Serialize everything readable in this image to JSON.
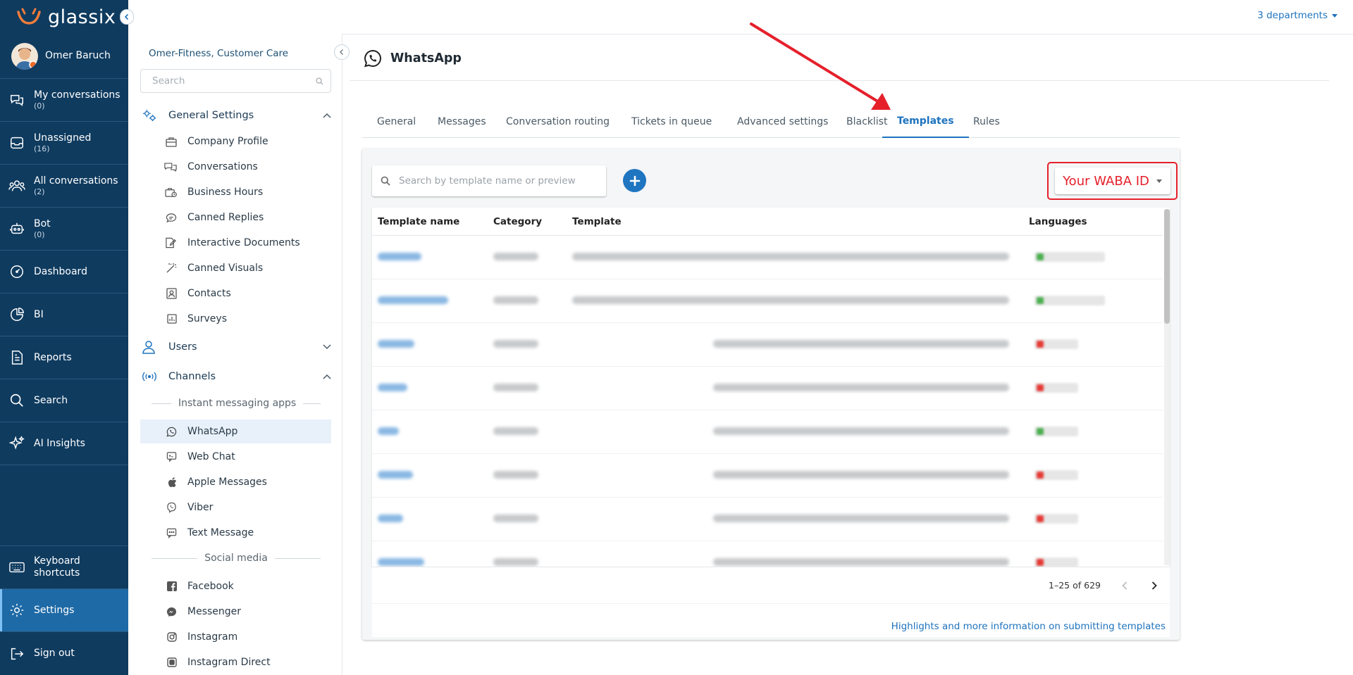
{
  "brand": {
    "name": "glassix"
  },
  "user": {
    "name": "Omer Baruch"
  },
  "nav": {
    "items": [
      {
        "label": "My conversations",
        "count": "(0)"
      },
      {
        "label": "Unassigned",
        "count": "(16)"
      },
      {
        "label": "All conversations",
        "count": "(2)"
      },
      {
        "label": "Bot",
        "count": "(0)"
      },
      {
        "label": "Dashboard"
      },
      {
        "label": "BI"
      },
      {
        "label": "Reports"
      },
      {
        "label": "Search"
      },
      {
        "label": "AI Insights"
      }
    ],
    "keyboard": "Keyboard shortcuts",
    "settings": "Settings",
    "signout": "Sign out"
  },
  "header": {
    "departments": "3 departments"
  },
  "sidebar": {
    "org": "Omer-Fitness, Customer Care",
    "search_placeholder": "Search",
    "general": {
      "label": "General Settings",
      "items": [
        "Company Profile",
        "Conversations",
        "Business Hours",
        "Canned Replies",
        "Interactive Documents",
        "Canned Visuals",
        "Contacts",
        "Surveys"
      ]
    },
    "users": "Users",
    "channels": {
      "label": "Channels",
      "group_im": "Instant messaging apps",
      "im_items": [
        "WhatsApp",
        "Web Chat",
        "Apple Messages",
        "Viber",
        "Text Message"
      ],
      "group_social": "Social media",
      "social_items": [
        "Facebook",
        "Messenger",
        "Instagram",
        "Instagram Direct"
      ]
    }
  },
  "page": {
    "title": "WhatsApp",
    "tabs": [
      "General",
      "Messages",
      "Conversation routing",
      "Tickets in queue",
      "Advanced settings",
      "Blacklist",
      "Templates",
      "Rules"
    ],
    "active_tab": "Templates"
  },
  "templates": {
    "search_placeholder": "Search by template name or preview",
    "waba": "Your WABA ID",
    "columns": [
      "Template name",
      "Category",
      "Template",
      "Languages"
    ],
    "pagination": "1–25 of 629",
    "help_link": "Highlights and more information on submitting templates",
    "rows": [
      {
        "status": "green"
      },
      {
        "status": "green"
      },
      {
        "status": "red"
      },
      {
        "status": "red"
      },
      {
        "status": "green"
      },
      {
        "status": "red"
      },
      {
        "status": "red"
      },
      {
        "status": "red"
      }
    ]
  },
  "colors": {
    "nav_bg": "#0f3b5f",
    "accent": "#1e73be",
    "highlight": "#e5202b"
  }
}
